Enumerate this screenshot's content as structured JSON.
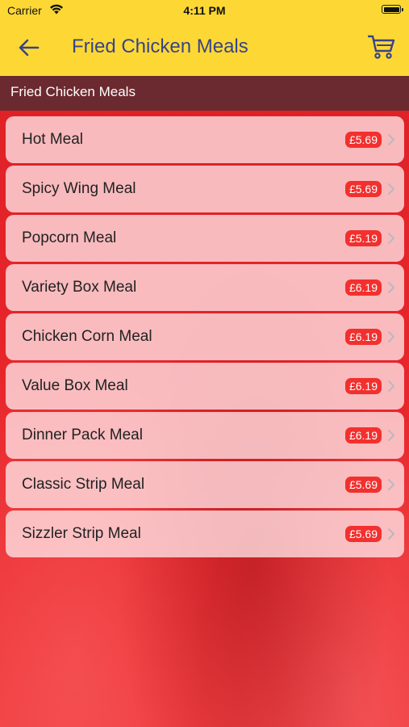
{
  "status_bar": {
    "carrier": "Carrier",
    "time": "4:11 PM"
  },
  "nav": {
    "title": "Fried Chicken Meals",
    "back_icon": "arrow-left-icon",
    "cart_icon": "cart-icon"
  },
  "section": {
    "title": "Fried Chicken Meals"
  },
  "items": [
    {
      "name": "Hot Meal",
      "price": "£5.69"
    },
    {
      "name": "Spicy Wing Meal",
      "price": "£5.69"
    },
    {
      "name": "Popcorn Meal",
      "price": "£5.19"
    },
    {
      "name": "Variety Box Meal",
      "price": "£6.19"
    },
    {
      "name": "Chicken Corn Meal",
      "price": "£6.19"
    },
    {
      "name": "Value Box Meal",
      "price": "£6.19"
    },
    {
      "name": "Dinner Pack Meal",
      "price": "£6.19"
    },
    {
      "name": "Classic Strip Meal",
      "price": "£5.69"
    },
    {
      "name": "Sizzler Strip Meal",
      "price": "£5.69"
    }
  ],
  "colors": {
    "header_yellow": "#fdd835",
    "title_blue": "#3a4486",
    "section_maroon": "#6b2a2f",
    "price_red": "#f2302e",
    "background_red": "#e8262b"
  }
}
